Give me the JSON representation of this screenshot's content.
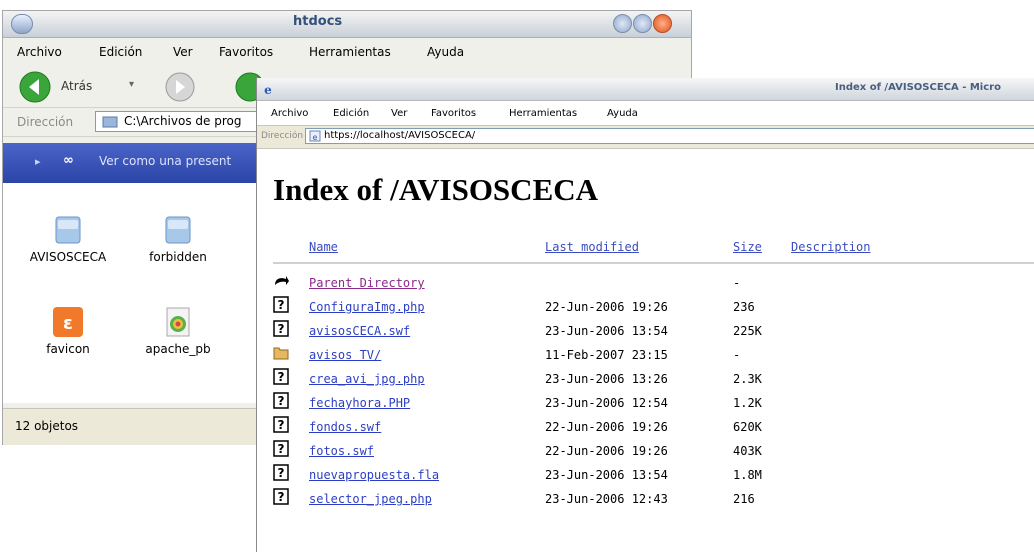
{
  "back_window": {
    "title": "htdocs",
    "menu": [
      "Archivo",
      "Edición",
      "Ver",
      "Favoritos",
      "Herramientas",
      "Ayuda"
    ],
    "back_label": "Atrás",
    "address_label": "Dirección",
    "address_value": "C:\\Archivos de prog",
    "task_text": "Ver como una present",
    "icons": [
      {
        "label": "AVISOSCECA",
        "icon": "folder-icon"
      },
      {
        "label": "forbidden",
        "icon": "folder-icon"
      },
      {
        "label": "favicon",
        "icon": "xampp-icon"
      },
      {
        "label": "apache_pb",
        "icon": "image-icon"
      }
    ],
    "status": "12 objetos"
  },
  "front_window": {
    "title": "Index of /AVISOSCECA - Micro",
    "menu": [
      "Archivo",
      "Edición",
      "Ver",
      "Favoritos",
      "Herramientas",
      "Ayuda"
    ],
    "address_label": "Dirección",
    "address_value": "https://localhost/AVISOSCECA/",
    "heading": "Index of /AVISOSCECA",
    "columns": {
      "name": "Name",
      "modified": "Last modified",
      "size": "Size",
      "description": "Description"
    },
    "rows": [
      {
        "icon": "back-icon",
        "name": "Parent Directory",
        "modified": "",
        "size": "-"
      },
      {
        "icon": "unknown-file-icon",
        "name": "ConfiguraImg.php",
        "modified": "22-Jun-2006 19:26",
        "size": "236"
      },
      {
        "icon": "unknown-file-icon",
        "name": "avisosCECA.swf",
        "modified": "23-Jun-2006 13:54",
        "size": "225K"
      },
      {
        "icon": "folder-icon",
        "name": "avisos TV/",
        "modified": "11-Feb-2007 23:15",
        "size": "-"
      },
      {
        "icon": "unknown-file-icon",
        "name": "crea_avi_jpg.php",
        "modified": "23-Jun-2006 13:26",
        "size": "2.3K"
      },
      {
        "icon": "unknown-file-icon",
        "name": "fechayhora.PHP",
        "modified": "23-Jun-2006 12:54",
        "size": "1.2K"
      },
      {
        "icon": "unknown-file-icon",
        "name": "fondos.swf",
        "modified": "22-Jun-2006 19:26",
        "size": "620K"
      },
      {
        "icon": "unknown-file-icon",
        "name": "fotos.swf",
        "modified": "22-Jun-2006 19:26",
        "size": "403K"
      },
      {
        "icon": "unknown-file-icon",
        "name": "nuevapropuesta.fla",
        "modified": "23-Jun-2006 13:54",
        "size": "1.8M"
      },
      {
        "icon": "unknown-file-icon",
        "name": "selector_jpeg.php",
        "modified": "23-Jun-2006 12:43",
        "size": "216"
      }
    ]
  }
}
